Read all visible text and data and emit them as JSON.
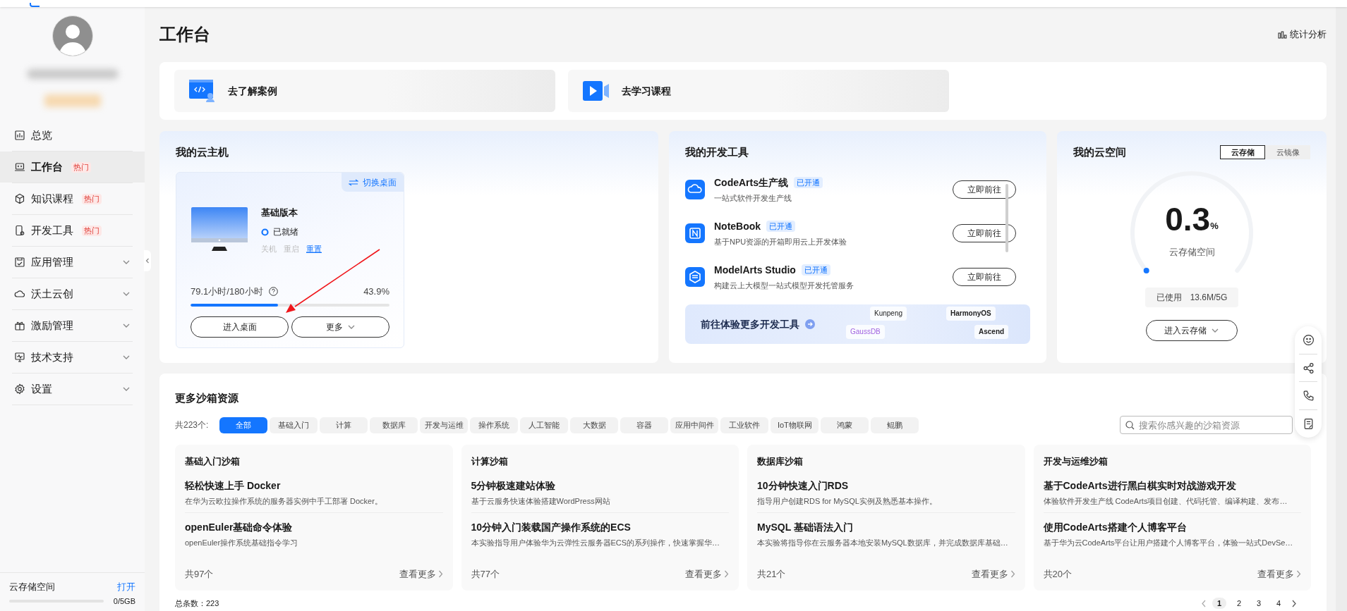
{
  "sidebar": {
    "items": [
      {
        "label": "总览",
        "kind": "link",
        "selected": false
      },
      {
        "label": "工作台",
        "kind": "link",
        "selected": true,
        "badge": "热门"
      },
      {
        "label": "知识课程",
        "kind": "link",
        "selected": false,
        "badge": "热门"
      },
      {
        "label": "开发工具",
        "kind": "link",
        "selected": false,
        "badge": "热门"
      },
      {
        "label": "应用管理",
        "kind": "group",
        "selected": false,
        "expanded": false
      },
      {
        "label": "沃土云创",
        "kind": "group",
        "selected": false,
        "expanded": false
      },
      {
        "label": "激励管理",
        "kind": "group",
        "selected": false,
        "expanded": false
      },
      {
        "label": "技术支持",
        "kind": "group",
        "selected": false,
        "expanded": false
      },
      {
        "label": "设置",
        "kind": "group",
        "selected": false,
        "expanded": false
      }
    ],
    "storage": {
      "label": "云存储空间",
      "action": "打开",
      "usage": "0/5GB"
    }
  },
  "page": {
    "title": "工作台",
    "stats_link": "统计分析"
  },
  "quick_links": [
    {
      "label": "去了解案例"
    },
    {
      "label": "去学习课程"
    }
  ],
  "cloud_host": {
    "title": "我的云主机",
    "switch": "切换桌面",
    "edition": "基础版本",
    "status": "已就绪",
    "actions": [
      {
        "label": "关机",
        "disabled": true
      },
      {
        "label": "重启",
        "disabled": true
      },
      {
        "label": "重置",
        "disabled": false
      }
    ],
    "usage": "79.1小时/180小时",
    "percent": "43.9%",
    "level": 0.439,
    "buttons": [
      {
        "label": "进入桌面",
        "dropdown": false
      },
      {
        "label": "更多",
        "dropdown": true
      }
    ]
  },
  "dev_tools": {
    "title": "我的开发工具",
    "items": [
      {
        "name": "CodeArts生产线",
        "badge": "已开通",
        "description": "一站式软件开发生产线",
        "button": "立即前往"
      },
      {
        "name": "NoteBook",
        "badge": "已开通",
        "description": "基于NPU资源的开箱即用云上开发体验",
        "button": "立即前往"
      },
      {
        "name": "ModelArts Studio",
        "badge": "已开通",
        "description": "构建云上大模型一站式模型开发托管服务",
        "button": "立即前往"
      }
    ],
    "banner": {
      "label": "前往体验更多开发工具",
      "logos": [
        "Kunpeng",
        "HarmonyOS",
        "GaussDB",
        "Ascend"
      ]
    }
  },
  "cloud_space": {
    "title": "我的云空间",
    "tabs": [
      {
        "label": "云存储",
        "selected": true
      },
      {
        "label": "云镜像",
        "selected": false
      }
    ],
    "value": "0.3",
    "unit": "%",
    "caption": "云存储空间",
    "used_label": "已使用",
    "used_value": "13.6M/5G",
    "button": "进入云存储"
  },
  "sandbox": {
    "title": "更多沙箱资源",
    "count": "共223个:",
    "filters": [
      {
        "label": "全部",
        "selected": true
      },
      {
        "label": "基础入门",
        "selected": false
      },
      {
        "label": "计算",
        "selected": false
      },
      {
        "label": "数据库",
        "selected": false
      },
      {
        "label": "开发与运维",
        "selected": false
      },
      {
        "label": "操作系统",
        "selected": false
      },
      {
        "label": "人工智能",
        "selected": false
      },
      {
        "label": "大数据",
        "selected": false
      },
      {
        "label": "容器",
        "selected": false
      },
      {
        "label": "应用中间件",
        "selected": false
      },
      {
        "label": "工业软件",
        "selected": false
      },
      {
        "label": "IoT物联网",
        "selected": false
      },
      {
        "label": "鸿蒙",
        "selected": false
      },
      {
        "label": "鲲鹏",
        "selected": false
      }
    ],
    "search": {
      "placeholder": "搜索你感兴趣的沙箱资源"
    },
    "cards": [
      {
        "title": "基础入门沙箱",
        "items": [
          {
            "title": "轻松快速上手 Docker",
            "description": "在华为云欧拉操作系统的服务器实例中手工部署 Docker。"
          },
          {
            "title": "openEuler基础命令体验",
            "description": "openEuler操作系统基础指令学习"
          }
        ],
        "count": "共97个",
        "more": "查看更多"
      },
      {
        "title": "计算沙箱",
        "items": [
          {
            "title": "5分钟极速建站体验",
            "description": "基于云服务快速体验搭建WordPress网站"
          },
          {
            "title": "10分钟入门装载国产操作系统的ECS",
            "description": "本实验指导用户体验华为云弹性云服务器ECS的系列操作，快速掌握华…"
          }
        ],
        "count": "共77个",
        "more": "查看更多"
      },
      {
        "title": "数据库沙箱",
        "items": [
          {
            "title": "10分钟快速入门RDS",
            "description": "指导用户创建RDS for MySQL实例及熟悉基本操作。"
          },
          {
            "title": "MySQL 基础语法入门",
            "description": "本实验将指导你在云服务器本地安装MySQL数据库，并完成数据库基础…"
          }
        ],
        "count": "共21个",
        "more": "查看更多"
      },
      {
        "title": "开发与运维沙箱",
        "items": [
          {
            "title": "基于CodeArts进行黑白棋实时对战游戏开发",
            "description": "体验软件开发生产线 CodeArts项目创建、代码托管、编译构建、发布…"
          },
          {
            "title": "使用CodeArts搭建个人博客平台",
            "description": "基于华为云CodeArts平台让用户搭建个人博客平台，体验一站式DevSe…"
          }
        ],
        "count": "共20个",
        "more": "查看更多"
      }
    ],
    "total": "总条数：223",
    "pages": [
      {
        "label": "1",
        "selected": true
      },
      {
        "label": "2",
        "selected": false
      },
      {
        "label": "3",
        "selected": false
      },
      {
        "label": "4",
        "selected": false
      }
    ]
  }
}
